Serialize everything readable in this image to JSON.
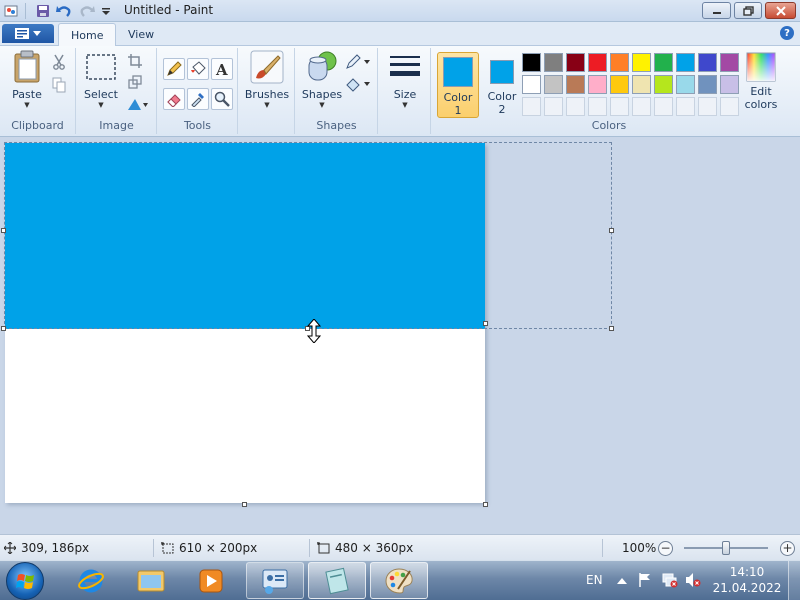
{
  "window": {
    "title": "Untitled - Paint"
  },
  "tabs": [
    {
      "label": "Home"
    },
    {
      "label": "View"
    }
  ],
  "ribbon": {
    "clipboard": {
      "paste_label": "Paste",
      "group_label": "Clipboard"
    },
    "image": {
      "select_label": "Select",
      "group_label": "Image"
    },
    "tools": {
      "group_label": "Tools"
    },
    "brushes": {
      "label": "Brushes"
    },
    "shapes": {
      "shapes_label": "Shapes",
      "group_label": "Shapes"
    },
    "size": {
      "label": "Size"
    },
    "colors": {
      "color1_label": "Color",
      "color1_num": "1",
      "color2_label": "Color",
      "color2_num": "2",
      "color1_value": "#00a2e8",
      "color2_value": "#00a2e8",
      "edit_label_1": "Edit",
      "edit_label_2": "colors",
      "group_label": "Colors",
      "palette_row1": [
        "#000000",
        "#7f7f7f",
        "#880015",
        "#ed1c24",
        "#ff7f27",
        "#fff200",
        "#22b14c",
        "#00a2e8",
        "#3f48cc",
        "#a349a4"
      ],
      "palette_row2": [
        "#ffffff",
        "#c3c3c3",
        "#b97a57",
        "#ffaec9",
        "#ffc90e",
        "#efe4b0",
        "#b5e61d",
        "#99d9ea",
        "#7092be",
        "#c8bfe7"
      ]
    }
  },
  "canvas": {
    "fill_color": "#00a2e8",
    "background": "#ffffff"
  },
  "statusbar": {
    "cursor_pos": "309, 186px",
    "selection_size": "610 × 200px",
    "image_size": "480 × 360px",
    "zoom": "100%"
  },
  "taskbar": {
    "language": "EN",
    "time": "14:10",
    "date": "21.04.2022"
  }
}
